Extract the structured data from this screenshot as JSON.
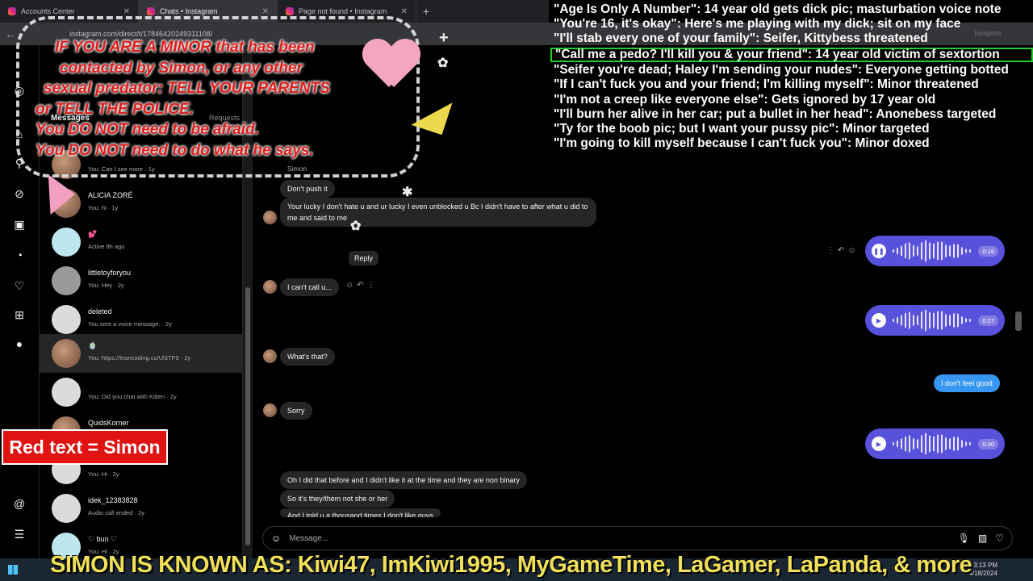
{
  "browser": {
    "tabs": [
      {
        "label": "Accounts Center"
      },
      {
        "label": "Chats • Instagram"
      },
      {
        "label": "Page not found • Instagram"
      }
    ],
    "url": "instagram.com/direct/t/17846420249311108/",
    "incognito_label": "Incognito"
  },
  "inbox": {
    "messages_header": "Messages",
    "requests_header": "Requests",
    "conversations": [
      {
        "name": "",
        "preview": "You: Can I see more · 1y"
      },
      {
        "name": "ALICIA ZORÉ",
        "preview": "You: hi · 1y"
      },
      {
        "name": "💕",
        "preview": "Active 9h ago"
      },
      {
        "name": "littletoyforyou",
        "preview": "You: Hey · 2y"
      },
      {
        "name": "deleted",
        "preview": "You sent a voice message. · 2y"
      },
      {
        "name": "🍵",
        "preview": "You: https://leancoding.co/Ul3TP9 · 2y"
      },
      {
        "name": "",
        "preview": "You: Did you chat with Kitten · 2y"
      },
      {
        "name": "QuidsKorner",
        "preview": ""
      },
      {
        "name": "",
        "preview": "You: Hi · 2y"
      },
      {
        "name": "idek_12383828",
        "preview": "Audio call ended · 2y"
      },
      {
        "name": "♡ bun ♡",
        "preview": "You: Hi · 2y"
      }
    ]
  },
  "chat": {
    "sender_label": "Simon",
    "messages": [
      {
        "from": "them",
        "text": "Don't push it"
      },
      {
        "from": "them",
        "text": "Your lucky I don't hate u and ur lucky I even unblocked u Bc I didn't have to after what u did to me and said to me"
      },
      {
        "from": "them",
        "text": "I can't call u..."
      },
      {
        "from": "them",
        "text": "What's that?"
      },
      {
        "from": "them",
        "text": "Sorry"
      },
      {
        "from": "me",
        "text": "I don't feel good"
      },
      {
        "from": "them",
        "text": "Oh I did that before and I didn't like it at the time and they are non binary"
      },
      {
        "from": "them",
        "text": "So it's they/them not she or her"
      },
      {
        "from": "them",
        "text": "And I told u a thousand times I don't like guys"
      }
    ],
    "voice_messages": [
      {
        "duration": "0:16"
      },
      {
        "duration": "0:27"
      },
      {
        "duration": "0:30"
      }
    ],
    "reply_tooltip": "Reply",
    "composer_placeholder": "Message..."
  },
  "overlay": {
    "warning_lines": [
      "IF YOU ARE A MINOR that has been",
      "contacted by Simon, or any other",
      "sexual predator: TELL YOUR PARENTS",
      "or TELL THE POLICE.",
      "You DO NOT need to be afraid.",
      "You DO NOT need to do what he says."
    ],
    "quotes": [
      "\"Age Is Only A Number\": 14 year old gets dick pic; masturbation voice note",
      "\"You're 16, it's okay\": Here's me playing with my dick; sit on my face",
      "\"I'll stab every one of your family\": Seifer, Kittybess threatened",
      "\"Call me a pedo? I'll kill you & your friend\": 14 year old victim of sextortion",
      "\"Seifer you're dead; Haley I'm sending your nudes\": Everyone getting botted",
      "\"If I can't fuck you and your friend; I'm killing myself\": Minor threatened",
      "\"I'm not a creep like everyone else\": Gets ignored by 17 year old",
      "\"I'll burn her alive in her car; put a bullet in her head\": Anonebess targeted",
      "\"Ty for the boob pic; but I want your pussy pic\": Minor targeted",
      "\"I'm going to kill myself because I can't fuck you\": Minor doxed"
    ],
    "highlighted_quote_index": 3,
    "red_tag": "Red text = Simon",
    "banner": "SIMON IS KNOWN AS: Kiwi47, ImKiwi1995, MyGameTime, LaGamer, LaPanda, & more",
    "colors": {
      "warning_red": "#e01b1b",
      "highlight_green": "#1fcf2a",
      "banner_yellow": "#f0e05a",
      "voice_purple": "#5851db",
      "my_bubble": "#3797f0"
    }
  },
  "taskbar": {
    "clock_time": "3:13 PM",
    "clock_date": "4/18/2024"
  }
}
